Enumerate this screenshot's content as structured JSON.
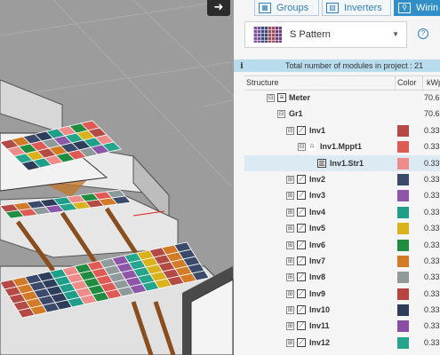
{
  "tabs": [
    {
      "label": "Groups",
      "icon": "groups-icon",
      "active": false
    },
    {
      "label": "Inverters",
      "icon": "inverter-icon",
      "active": false
    },
    {
      "label": "Wirin",
      "icon": "wiring-icon",
      "active": true
    }
  ],
  "pattern": {
    "selected": "S Pattern"
  },
  "info": {
    "icon": "i",
    "text": "Total number of modules in project : 21"
  },
  "grid": {
    "col_structure": "Structure",
    "col_color": "Color",
    "col_kw": "kWp"
  },
  "tree": [
    {
      "label": "Meter",
      "expander": "⊟",
      "icon": "meter-icon",
      "kw": "70.6",
      "color": ""
    },
    {
      "label": "Gr1",
      "expander": "⊟",
      "icon": "",
      "kw": "70.6",
      "color": ""
    },
    {
      "label": "Inv1",
      "expander": "⊟",
      "icon": "inverter-icon",
      "kw": "0.33",
      "color": "#b44a45"
    },
    {
      "label": "Inv1.Mppt1",
      "expander": "⊟",
      "icon": "mppt-icon",
      "kw": "0.33",
      "color": "#e05a55"
    },
    {
      "label": "Inv1.Str1",
      "expander": "",
      "icon": "string-icon",
      "kw": "0.33",
      "color": "#ef8c8a"
    },
    {
      "label": "Inv2",
      "expander": "⊞",
      "icon": "inverter-icon",
      "kw": "0.33",
      "color": "#3b4a6b"
    },
    {
      "label": "Inv3",
      "expander": "⊞",
      "icon": "inverter-icon",
      "kw": "0.33",
      "color": "#8e56a8"
    },
    {
      "label": "Inv4",
      "expander": "⊞",
      "icon": "inverter-icon",
      "kw": "0.33",
      "color": "#1f9e8a"
    },
    {
      "label": "Inv5",
      "expander": "⊞",
      "icon": "inverter-icon",
      "kw": "0.33",
      "color": "#d9b21c"
    },
    {
      "label": "Inv6",
      "expander": "⊞",
      "icon": "inverter-icon",
      "kw": "0.33",
      "color": "#1f8c3f"
    },
    {
      "label": "Inv7",
      "expander": "⊞",
      "icon": "inverter-icon",
      "kw": "0.33",
      "color": "#d27a26"
    },
    {
      "label": "Inv8",
      "expander": "⊞",
      "icon": "inverter-icon",
      "kw": "0.33",
      "color": "#8f9a9a"
    },
    {
      "label": "Inv9",
      "expander": "⊞",
      "icon": "inverter-icon",
      "kw": "0.33",
      "color": "#b8443f"
    },
    {
      "label": "Inv10",
      "expander": "⊞",
      "icon": "inverter-icon",
      "kw": "0.33",
      "color": "#2e3d5a"
    },
    {
      "label": "Inv11",
      "expander": "⊞",
      "icon": "inverter-icon",
      "kw": "0.33",
      "color": "#8a4fa3"
    },
    {
      "label": "Inv12",
      "expander": "⊞",
      "icon": "inverter-icon",
      "kw": "0.33",
      "color": "#26a58d"
    }
  ]
}
